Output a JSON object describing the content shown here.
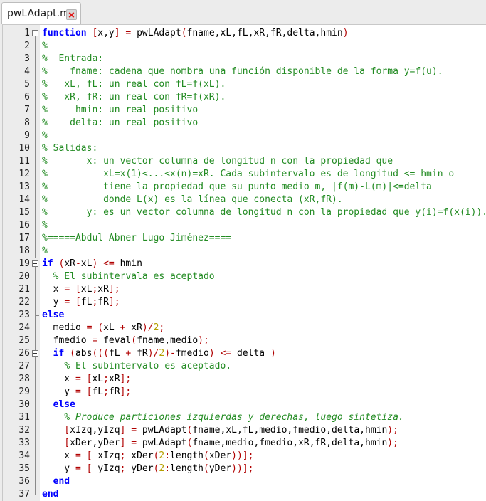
{
  "tab": {
    "filename": "pwLAdapt.m",
    "close_icon": "close-icon"
  },
  "editor": {
    "lines": [
      {
        "n": "1",
        "fold": true,
        "segs": [
          {
            "t": "function",
            "c": "kw"
          },
          {
            "t": " "
          },
          {
            "t": "[",
            "c": "op"
          },
          {
            "t": "x,y"
          },
          {
            "t": "]",
            "c": "op"
          },
          {
            "t": " "
          },
          {
            "t": "=",
            "c": "op"
          },
          {
            "t": " pwLAdapt"
          },
          {
            "t": "(",
            "c": "op"
          },
          {
            "t": "fname,xL,fL,xR,fR,delta,hmin"
          },
          {
            "t": ")",
            "c": "op"
          }
        ]
      },
      {
        "n": "2",
        "segs": [
          {
            "t": "%",
            "c": "cm"
          }
        ]
      },
      {
        "n": "3",
        "segs": [
          {
            "t": "%  Entrada:",
            "c": "cm"
          }
        ]
      },
      {
        "n": "4",
        "segs": [
          {
            "t": "%    fname: cadena que nombra una función disponible de la forma y=f(u).",
            "c": "cm"
          }
        ]
      },
      {
        "n": "5",
        "segs": [
          {
            "t": "%   xL, fL: un real con fL=f(xL).",
            "c": "cm"
          }
        ]
      },
      {
        "n": "6",
        "segs": [
          {
            "t": "%   xR, fR: un real con fR=f(xR).",
            "c": "cm"
          }
        ]
      },
      {
        "n": "7",
        "segs": [
          {
            "t": "%     hmin: un real positivo",
            "c": "cm"
          }
        ]
      },
      {
        "n": "8",
        "segs": [
          {
            "t": "%    delta: un real positivo",
            "c": "cm"
          }
        ]
      },
      {
        "n": "9",
        "segs": [
          {
            "t": "%",
            "c": "cm"
          }
        ]
      },
      {
        "n": "10",
        "segs": [
          {
            "t": "% Salidas:",
            "c": "cm"
          }
        ]
      },
      {
        "n": "11",
        "segs": [
          {
            "t": "%       x: un vector columna de longitud n con la propiedad que",
            "c": "cm"
          }
        ]
      },
      {
        "n": "12",
        "segs": [
          {
            "t": "%          xL=x(1)<...<x(n)=xR. Cada subintervalo es de longitud <= hmin o",
            "c": "cm"
          }
        ]
      },
      {
        "n": "13",
        "segs": [
          {
            "t": "%          tiene la propiedad que su punto medio m, |f(m)-L(m)|<=delta",
            "c": "cm"
          }
        ]
      },
      {
        "n": "14",
        "segs": [
          {
            "t": "%          donde L(x) es la línea que conecta (xR,fR).",
            "c": "cm"
          }
        ]
      },
      {
        "n": "15",
        "segs": [
          {
            "t": "%       y: es un vector columna de longitud n con la propiedad que y(i)=f(x(i)).",
            "c": "cm"
          }
        ]
      },
      {
        "n": "16",
        "segs": [
          {
            "t": "%",
            "c": "cm"
          }
        ]
      },
      {
        "n": "17",
        "segs": [
          {
            "t": "%=====Abdul Abner Lugo Jiménez====",
            "c": "cm"
          }
        ]
      },
      {
        "n": "18",
        "segs": [
          {
            "t": "%",
            "c": "cm"
          }
        ]
      },
      {
        "n": "19",
        "fold": true,
        "segs": [
          {
            "t": "if",
            "c": "kw"
          },
          {
            "t": " "
          },
          {
            "t": "(",
            "c": "op"
          },
          {
            "t": "xR"
          },
          {
            "t": "-",
            "c": "op"
          },
          {
            "t": "xL"
          },
          {
            "t": ")",
            "c": "op"
          },
          {
            "t": " "
          },
          {
            "t": "<=",
            "c": "op"
          },
          {
            "t": " hmin"
          }
        ]
      },
      {
        "n": "20",
        "segs": [
          {
            "t": "  "
          },
          {
            "t": "% El subintervala es aceptado",
            "c": "cm"
          }
        ]
      },
      {
        "n": "21",
        "segs": [
          {
            "t": "  x "
          },
          {
            "t": "=",
            "c": "op"
          },
          {
            "t": " "
          },
          {
            "t": "[",
            "c": "op"
          },
          {
            "t": "xL"
          },
          {
            "t": ";",
            "c": "op"
          },
          {
            "t": "xR"
          },
          {
            "t": "]",
            "c": "op"
          },
          {
            "t": ";",
            "c": "op"
          }
        ]
      },
      {
        "n": "22",
        "segs": [
          {
            "t": "  y "
          },
          {
            "t": "=",
            "c": "op"
          },
          {
            "t": " "
          },
          {
            "t": "[",
            "c": "op"
          },
          {
            "t": "fL"
          },
          {
            "t": ";",
            "c": "op"
          },
          {
            "t": "fR"
          },
          {
            "t": "]",
            "c": "op"
          },
          {
            "t": ";",
            "c": "op"
          }
        ]
      },
      {
        "n": "23",
        "segs": [
          {
            "t": "else",
            "c": "kw"
          }
        ]
      },
      {
        "n": "24",
        "segs": [
          {
            "t": "  medio "
          },
          {
            "t": "=",
            "c": "op"
          },
          {
            "t": " "
          },
          {
            "t": "(",
            "c": "op"
          },
          {
            "t": "xL "
          },
          {
            "t": "+",
            "c": "op"
          },
          {
            "t": " xR"
          },
          {
            "t": ")",
            "c": "op"
          },
          {
            "t": "/",
            "c": "op"
          },
          {
            "t": "2",
            "c": "num"
          },
          {
            "t": ";",
            "c": "op"
          }
        ]
      },
      {
        "n": "25",
        "segs": [
          {
            "t": "  fmedio "
          },
          {
            "t": "=",
            "c": "op"
          },
          {
            "t": " feval"
          },
          {
            "t": "(",
            "c": "op"
          },
          {
            "t": "fname,medio"
          },
          {
            "t": ")",
            "c": "op"
          },
          {
            "t": ";",
            "c": "op"
          }
        ]
      },
      {
        "n": "26",
        "fold": true,
        "segs": [
          {
            "t": "  "
          },
          {
            "t": "if",
            "c": "kw"
          },
          {
            "t": " "
          },
          {
            "t": "(",
            "c": "op"
          },
          {
            "t": "abs"
          },
          {
            "t": "(((",
            "c": "op"
          },
          {
            "t": "fL "
          },
          {
            "t": "+",
            "c": "op"
          },
          {
            "t": " fR"
          },
          {
            "t": ")",
            "c": "op"
          },
          {
            "t": "/",
            "c": "op"
          },
          {
            "t": "2",
            "c": "num"
          },
          {
            "t": ")",
            "c": "op"
          },
          {
            "t": "-",
            "c": "op"
          },
          {
            "t": "fmedio"
          },
          {
            "t": ")",
            "c": "op"
          },
          {
            "t": " "
          },
          {
            "t": "<=",
            "c": "op"
          },
          {
            "t": " delta "
          },
          {
            "t": ")",
            "c": "op"
          }
        ]
      },
      {
        "n": "27",
        "segs": [
          {
            "t": "    "
          },
          {
            "t": "% El subintervalo es aceptado.",
            "c": "cm"
          }
        ]
      },
      {
        "n": "28",
        "segs": [
          {
            "t": "    x "
          },
          {
            "t": "=",
            "c": "op"
          },
          {
            "t": " "
          },
          {
            "t": "[",
            "c": "op"
          },
          {
            "t": "xL"
          },
          {
            "t": ";",
            "c": "op"
          },
          {
            "t": "xR"
          },
          {
            "t": "]",
            "c": "op"
          },
          {
            "t": ";",
            "c": "op"
          }
        ]
      },
      {
        "n": "29",
        "segs": [
          {
            "t": "    y "
          },
          {
            "t": "=",
            "c": "op"
          },
          {
            "t": " "
          },
          {
            "t": "[",
            "c": "op"
          },
          {
            "t": "fL"
          },
          {
            "t": ";",
            "c": "op"
          },
          {
            "t": "fR"
          },
          {
            "t": "]",
            "c": "op"
          },
          {
            "t": ";",
            "c": "op"
          }
        ]
      },
      {
        "n": "30",
        "segs": [
          {
            "t": "  "
          },
          {
            "t": "else",
            "c": "kw"
          }
        ]
      },
      {
        "n": "31",
        "segs": [
          {
            "t": "    "
          },
          {
            "t": "% Produce particiones izquierdas y derechas, luego sintetiza.",
            "c": "cmi"
          }
        ]
      },
      {
        "n": "32",
        "segs": [
          {
            "t": "    "
          },
          {
            "t": "[",
            "c": "op"
          },
          {
            "t": "xIzq,yIzq"
          },
          {
            "t": "]",
            "c": "op"
          },
          {
            "t": " "
          },
          {
            "t": "=",
            "c": "op"
          },
          {
            "t": " pwLAdapt"
          },
          {
            "t": "(",
            "c": "op"
          },
          {
            "t": "fname,xL,fL,medio,fmedio,delta,hmin"
          },
          {
            "t": ")",
            "c": "op"
          },
          {
            "t": ";",
            "c": "op"
          }
        ]
      },
      {
        "n": "33",
        "segs": [
          {
            "t": "    "
          },
          {
            "t": "[",
            "c": "op"
          },
          {
            "t": "xDer,yDer"
          },
          {
            "t": "]",
            "c": "op"
          },
          {
            "t": " "
          },
          {
            "t": "=",
            "c": "op"
          },
          {
            "t": " pwLAdapt"
          },
          {
            "t": "(",
            "c": "op"
          },
          {
            "t": "fname,medio,fmedio,xR,fR,delta,hmin"
          },
          {
            "t": ")",
            "c": "op"
          },
          {
            "t": ";",
            "c": "op"
          }
        ]
      },
      {
        "n": "34",
        "segs": [
          {
            "t": "    x "
          },
          {
            "t": "=",
            "c": "op"
          },
          {
            "t": " "
          },
          {
            "t": "[",
            "c": "op"
          },
          {
            "t": " xIzq"
          },
          {
            "t": ";",
            "c": "op"
          },
          {
            "t": " xDer"
          },
          {
            "t": "(",
            "c": "op"
          },
          {
            "t": "2",
            "c": "num"
          },
          {
            "t": ":",
            "c": "op"
          },
          {
            "t": "length"
          },
          {
            "t": "(",
            "c": "op"
          },
          {
            "t": "xDer"
          },
          {
            "t": "))",
            "c": "op"
          },
          {
            "t": "]",
            "c": "op"
          },
          {
            "t": ";",
            "c": "op"
          }
        ]
      },
      {
        "n": "35",
        "segs": [
          {
            "t": "    y "
          },
          {
            "t": "=",
            "c": "op"
          },
          {
            "t": " "
          },
          {
            "t": "[",
            "c": "op"
          },
          {
            "t": " yIzq"
          },
          {
            "t": ";",
            "c": "op"
          },
          {
            "t": " yDer"
          },
          {
            "t": "(",
            "c": "op"
          },
          {
            "t": "2",
            "c": "num"
          },
          {
            "t": ":",
            "c": "op"
          },
          {
            "t": "length"
          },
          {
            "t": "(",
            "c": "op"
          },
          {
            "t": "yDer"
          },
          {
            "t": "))",
            "c": "op"
          },
          {
            "t": "]",
            "c": "op"
          },
          {
            "t": ";",
            "c": "op"
          }
        ]
      },
      {
        "n": "36",
        "segs": [
          {
            "t": "  "
          },
          {
            "t": "end",
            "c": "kw"
          }
        ]
      },
      {
        "n": "37",
        "segs": [
          {
            "t": "end",
            "c": "kw"
          }
        ]
      }
    ]
  }
}
